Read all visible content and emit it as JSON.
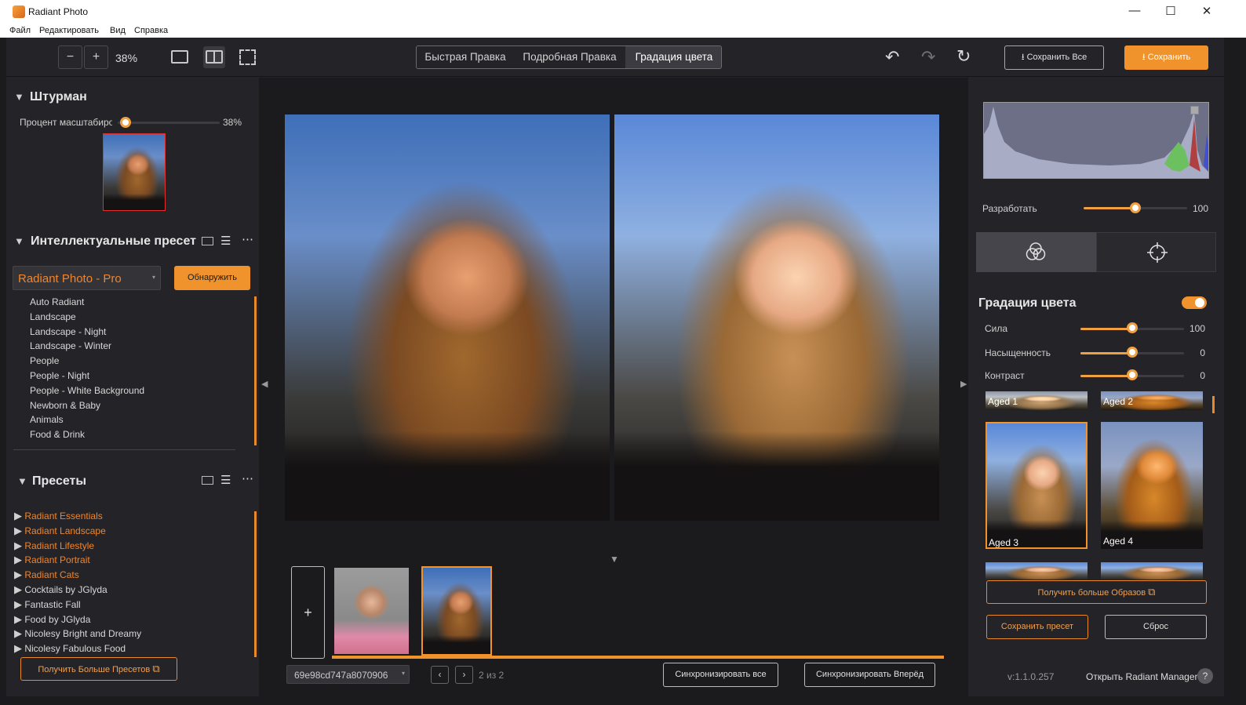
{
  "window": {
    "title": "Radiant Photo",
    "minimize": "—",
    "maximize": "☐",
    "close": "✕"
  },
  "menu": [
    "Файл",
    "Редактировать",
    "Вид",
    "Справка"
  ],
  "toolbar": {
    "zoom_out": "−",
    "zoom_in": "+",
    "zoom_value": "38%",
    "tabs": [
      "Быстрая Правка",
      "Подробная Правка",
      "Градация цвета"
    ],
    "active_tab": "Градация цвета",
    "save_all": "Сохранить Все",
    "save": "Сохранить"
  },
  "navigator": {
    "title": "Штурман",
    "zoom_label": "Процент масштабирования",
    "zoom_value": "38%",
    "zoom_fraction": 0.0
  },
  "smart_presets": {
    "title": "Интеллектуальные пресеты",
    "product": "Radiant Photo - Pro",
    "detect": "Обнаружить",
    "items": [
      "Auto Radiant",
      "Landscape",
      "Landscape - Night",
      "Landscape - Winter",
      "People",
      "People - Night",
      "People - White Background",
      "Newborn & Baby",
      "Animals",
      "Food & Drink"
    ]
  },
  "presets": {
    "title": "Пресеты",
    "items": [
      {
        "label": "Radiant Essentials",
        "highlight": true
      },
      {
        "label": "Radiant Landscape",
        "highlight": true
      },
      {
        "label": "Radiant Lifestyle",
        "highlight": true
      },
      {
        "label": "Radiant Portrait",
        "highlight": true
      },
      {
        "label": "Radiant Cats",
        "highlight": true
      },
      {
        "label": "Cocktails by JGlyda",
        "highlight": false
      },
      {
        "label": "Fantastic Fall",
        "highlight": false
      },
      {
        "label": "Food by JGlyda",
        "highlight": false
      },
      {
        "label": "Nicolesy Bright and Dreamy",
        "highlight": false
      },
      {
        "label": "Nicolesy Fabulous Food",
        "highlight": false
      }
    ],
    "get_more": "Получить Больше Пресетов"
  },
  "filmstrip": {
    "add": "+",
    "file_select": "69e98cd747a8070906",
    "counter": "2 из 2",
    "sync_all": "Синхронизировать все",
    "sync_forward": "Синхронизировать Вперёд"
  },
  "right": {
    "develop_label": "Разработать",
    "develop_value": "100",
    "develop_fraction": 0.5,
    "color_grading_title": "Градация цвета",
    "toggle_on": true,
    "sliders": [
      {
        "label": "Сила",
        "value": "100",
        "fraction": 0.5
      },
      {
        "label": "Насыщенность",
        "value": "0",
        "fraction": 0.5
      },
      {
        "label": "Контраст",
        "value": "0",
        "fraction": 0.5
      }
    ],
    "looks": [
      "Aged 1",
      "Aged 2",
      "Aged 3",
      "Aged 4"
    ],
    "selected_look": "Aged 3",
    "get_more_looks": "Получить больше Образов",
    "save_preset": "Сохранить пресет",
    "reset": "Сброс",
    "version": "v:1.1.0.257",
    "open_manager": "Открыть Radiant Manager",
    "help": "?"
  },
  "colors": {
    "accent": "#f0852b",
    "panel": "#242428",
    "canvas": "#1b1b1e"
  }
}
